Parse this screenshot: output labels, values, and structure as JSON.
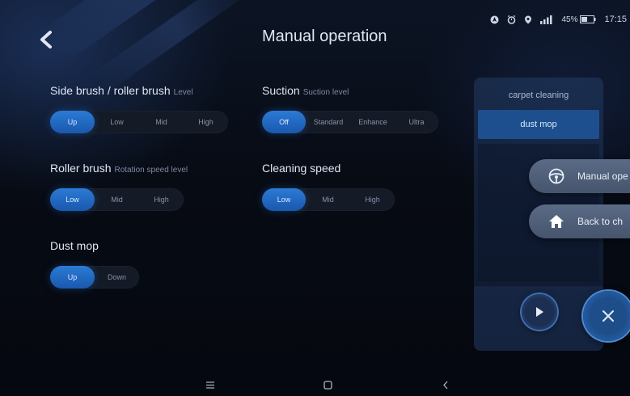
{
  "header": {
    "title": "Manual operation"
  },
  "status_bar": {
    "battery": "45%",
    "time": "17:15"
  },
  "side_brush": {
    "title": "Side brush / roller brush",
    "subtitle": "Level",
    "options": [
      "Up",
      "Low",
      "Mid",
      "High"
    ],
    "selected": "Up"
  },
  "suction": {
    "title": "Suction",
    "subtitle": "Suction level",
    "options": [
      "Off",
      "Standard",
      "Enhance",
      "Ultra"
    ],
    "selected": "Off"
  },
  "roller_brush": {
    "title": "Roller brush",
    "subtitle": "Rotation speed level",
    "options": [
      "Low",
      "Mid",
      "High"
    ],
    "selected": "Low"
  },
  "cleaning_speed": {
    "title": "Cleaning speed",
    "options": [
      "Low",
      "Mid",
      "High"
    ],
    "selected": "Low"
  },
  "dust_mop": {
    "title": "Dust mop",
    "options": [
      "Up",
      "Down"
    ],
    "selected": "Up"
  },
  "mode_panel": {
    "items": [
      "carpet cleaning",
      "dust mop"
    ],
    "selected": "dust mop"
  },
  "floating_menu": {
    "manual": "Manual ope",
    "back": "Back to ch"
  },
  "colors": {
    "accent": "#1f63b8",
    "panel": "#1d4f8e",
    "background": "#05080f"
  }
}
